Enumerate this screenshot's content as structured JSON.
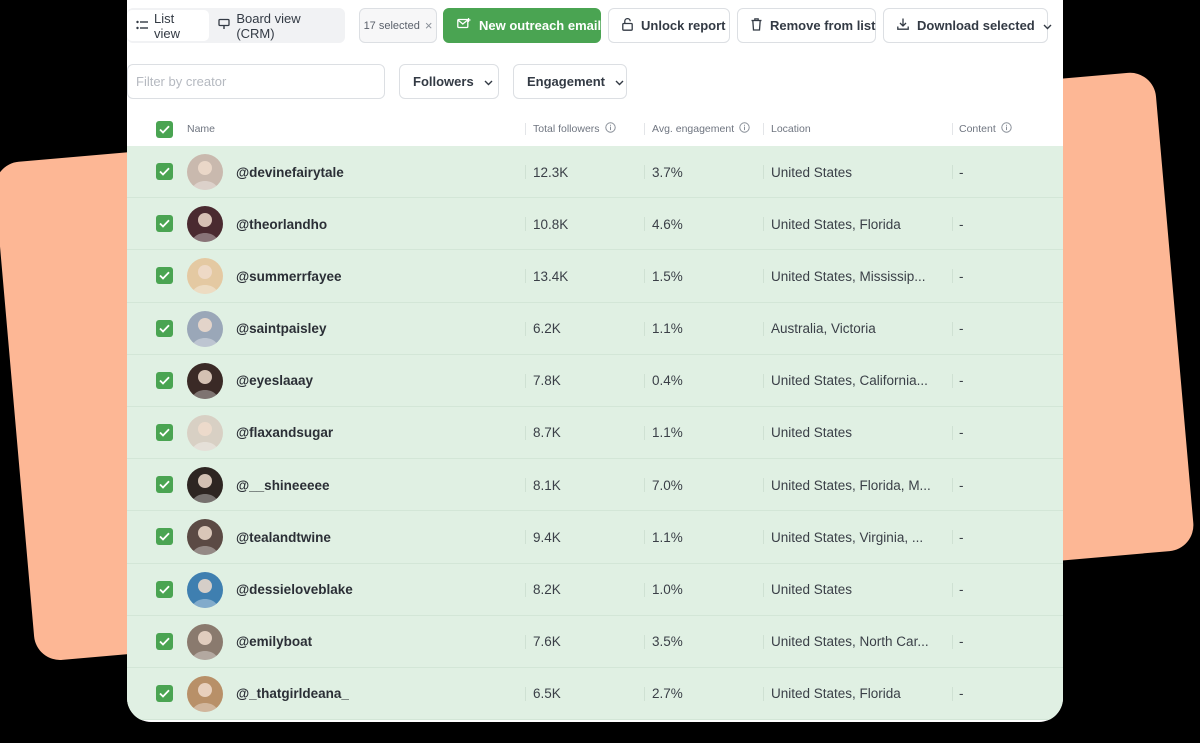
{
  "colors": {
    "accent": "#4aa452",
    "row_bg": "#e0f0e3",
    "backdrop_card": "#fdb795"
  },
  "toolbar": {
    "list_view_label": "List view",
    "board_view_label": "Board view (CRM)",
    "selected_chip": "17 selected",
    "selected_clear": "×",
    "new_outreach_label": "New outreach email",
    "unlock_report_label": "Unlock report",
    "remove_label": "Remove from list",
    "download_label": "Download selected"
  },
  "filters": {
    "search_placeholder": "Filter by creator",
    "followers_label": "Followers",
    "engagement_label": "Engagement"
  },
  "table": {
    "headers": {
      "name": "Name",
      "followers": "Total followers",
      "engagement": "Avg. engagement",
      "location": "Location",
      "content": "Content"
    },
    "rows": [
      {
        "handle": "@devinefairytale",
        "followers": "12.3K",
        "engagement": "3.7%",
        "location": "United States",
        "content": "-",
        "avatar_color": "#c9b9ae"
      },
      {
        "handle": "@theorlandho",
        "followers": "10.8K",
        "engagement": "4.6%",
        "location": "United States, Florida",
        "content": "-",
        "avatar_color": "#4a2a30"
      },
      {
        "handle": "@summerrfayee",
        "followers": "13.4K",
        "engagement": "1.5%",
        "location": "United States, Mississip...",
        "content": "-",
        "avatar_color": "#e4c9a2"
      },
      {
        "handle": "@saintpaisley",
        "followers": "6.2K",
        "engagement": "1.1%",
        "location": "Australia, Victoria",
        "content": "-",
        "avatar_color": "#9aa7b8"
      },
      {
        "handle": "@eyeslaaay",
        "followers": "7.8K",
        "engagement": "0.4%",
        "location": "United States, California...",
        "content": "-",
        "avatar_color": "#3a2a26"
      },
      {
        "handle": "@flaxandsugar",
        "followers": "8.7K",
        "engagement": "1.1%",
        "location": "United States",
        "content": "-",
        "avatar_color": "#d8d0c4"
      },
      {
        "handle": "@__shineeeee",
        "followers": "8.1K",
        "engagement": "7.0%",
        "location": "United States, Florida, M...",
        "content": "-",
        "avatar_color": "#2e2522"
      },
      {
        "handle": "@tealandtwine",
        "followers": "9.4K",
        "engagement": "1.1%",
        "location": "United States, Virginia, ...",
        "content": "-",
        "avatar_color": "#5b4a44"
      },
      {
        "handle": "@dessieloveblake",
        "followers": "8.2K",
        "engagement": "1.0%",
        "location": "United States",
        "content": "-",
        "avatar_color": "#3f7fb0"
      },
      {
        "handle": "@emilyboat",
        "followers": "7.6K",
        "engagement": "3.5%",
        "location": "United States, North Car...",
        "content": "-",
        "avatar_color": "#8a7a6e"
      },
      {
        "handle": "@_thatgirldeana_",
        "followers": "6.5K",
        "engagement": "2.7%",
        "location": "United States, Florida",
        "content": "-",
        "avatar_color": "#b89068"
      }
    ]
  }
}
